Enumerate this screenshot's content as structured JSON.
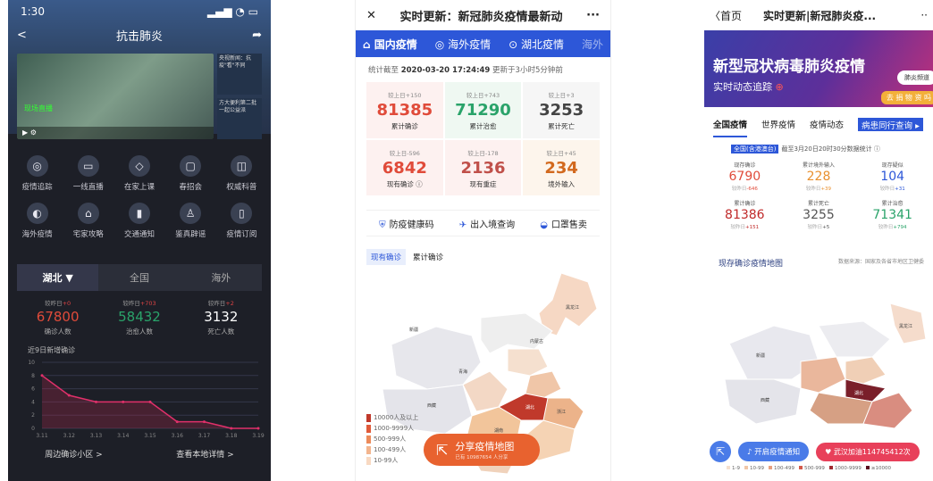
{
  "colors": {
    "red": "#e04b3a",
    "green": "#2aa36a",
    "blue": "#2d57d8",
    "orange": "#e8622f"
  },
  "p1": {
    "time": "1:30",
    "title": "抗击肺炎",
    "live": "现场直播",
    "side": [
      "央视新闻：抗疫\"看\"不同",
      "方大便利第二批一起公益派"
    ],
    "grid": [
      {
        "label": "疫情追踪",
        "icon": "◎"
      },
      {
        "label": "一线直播",
        "icon": "▭"
      },
      {
        "label": "在家上课",
        "icon": "◇"
      },
      {
        "label": "春招会",
        "icon": "▢"
      },
      {
        "label": "权威科普",
        "icon": "◫"
      },
      {
        "label": "海外疫情",
        "icon": "◐"
      },
      {
        "label": "宅家攻略",
        "icon": "⌂"
      },
      {
        "label": "交通通知",
        "icon": "▮"
      },
      {
        "label": "鉴真辟谣",
        "icon": "♙"
      },
      {
        "label": "疫情订阅",
        "icon": "▯"
      }
    ],
    "tabs": [
      "湖北 ▼",
      "全国",
      "海外"
    ],
    "stats": [
      {
        "diff_prefix": "较昨日",
        "diff": "+0",
        "value": "67800",
        "label": "确诊人数",
        "color": "#e04b3a"
      },
      {
        "diff_prefix": "较昨日",
        "diff": "+703",
        "value": "58432",
        "label": "治愈人数",
        "color": "#2aa36a"
      },
      {
        "diff_prefix": "较昨日",
        "diff": "+2",
        "value": "3132",
        "label": "死亡人数",
        "color": "#ffffff"
      }
    ],
    "chart_label": "近9日新增确诊",
    "footer": [
      "周边确诊小区 >",
      "查看本地详情 >"
    ]
  },
  "chart_data": {
    "type": "line",
    "title": "近9日新增确诊",
    "categories": [
      "3.11",
      "3.12",
      "3.13",
      "3.14",
      "3.15",
      "3.16",
      "3.17",
      "3.18",
      "3.19"
    ],
    "values": [
      8,
      5,
      4,
      4,
      4,
      1,
      1,
      0,
      0
    ],
    "ylim": [
      0,
      10
    ],
    "yticks": [
      0,
      2,
      4,
      6,
      8,
      10
    ]
  },
  "p2": {
    "title": "实时更新：新冠肺炎疫情最新动",
    "tabs": [
      "国内疫情",
      "海外疫情",
      "湖北疫情",
      "海外"
    ],
    "update_prefix": "统计截至 ",
    "update_time": "2020-03-20 17:24:49",
    "update_suffix": " 更新于3小时5分钟前",
    "cards": [
      {
        "diff": "较上日+150",
        "value": "81385",
        "label": "累计确诊",
        "color": "#e04b3a",
        "bg": "#fdf1f0"
      },
      {
        "diff": "较上日+743",
        "value": "71290",
        "label": "累计治愈",
        "color": "#2aa36a",
        "bg": "#eff8f2"
      },
      {
        "diff": "较上日+3",
        "value": "3253",
        "label": "累计死亡",
        "color": "#444444",
        "bg": "#f6f6f6"
      },
      {
        "diff": "较上日-596",
        "value": "6842",
        "label": "现有确诊 ⓘ",
        "color": "#e04b3a",
        "bg": "#fdf1f0"
      },
      {
        "diff": "较上日-178",
        "value": "2136",
        "label": "现有重症",
        "color": "#c0504a",
        "bg": "#fdf1f0"
      },
      {
        "diff": "较上日+45",
        "value": "234",
        "label": "境外输入",
        "color": "#d2691e",
        "bg": "#fdf5ec"
      }
    ],
    "services": [
      "防疫健康码",
      "出入境查询",
      "口罩售卖"
    ],
    "map_tabs": [
      "现有确诊",
      "累计确诊"
    ],
    "legend": [
      "10000人及以上",
      "1000-9999人",
      "500-999人",
      "100-499人",
      "10-99人"
    ],
    "share": "分享疫情地图",
    "share_sub": "已有 10987654 人分享"
  },
  "p3": {
    "back": "〈首页",
    "title": "实时更新|新冠肺炎疫...",
    "banner_title": "新型冠状病毒肺炎疫情",
    "banner_sub": "实时动态追踪",
    "pill": "肺炎频道",
    "pill2": "去 捐 物 资 吗",
    "tabs": [
      "全国疫情",
      "世界疫情",
      "疫情动态",
      "病患同行查询 ▸"
    ],
    "hk_tag": "全国(含港澳台)",
    "hk_text": "截至3月20日20时30分数据统计 ⓘ",
    "stats": [
      {
        "label": "现存确诊",
        "value": "6790",
        "diff_prefix": "较昨日",
        "diff": "-646",
        "color": "#e04b3a"
      },
      {
        "label": "累计境外输入",
        "value": "228",
        "diff_prefix": "较昨日",
        "diff": "+39",
        "color": "#e8902f"
      },
      {
        "label": "现存疑似",
        "value": "104",
        "diff_prefix": "较昨日",
        "diff": "+31",
        "color": "#2d57d8"
      },
      {
        "label": "累计确诊",
        "value": "81386",
        "diff_prefix": "较昨日",
        "diff": "+151",
        "color": "#c02a2a"
      },
      {
        "label": "累计死亡",
        "value": "3255",
        "diff_prefix": "较昨日",
        "diff": "+5",
        "color": "#555555"
      },
      {
        "label": "累计治愈",
        "value": "71341",
        "diff_prefix": "较昨日",
        "diff": "+794",
        "color": "#2aa36a"
      }
    ],
    "map_title": "现存确诊疫情地图",
    "map_source": "数据来源：国家及各省市地区卫健委",
    "notify": "开启疫情通知",
    "cheer": "武汉加油114745412次",
    "legend": [
      "1-9",
      "10-99",
      "100-499",
      "500-999",
      "1000-9999",
      "≥10000"
    ]
  }
}
